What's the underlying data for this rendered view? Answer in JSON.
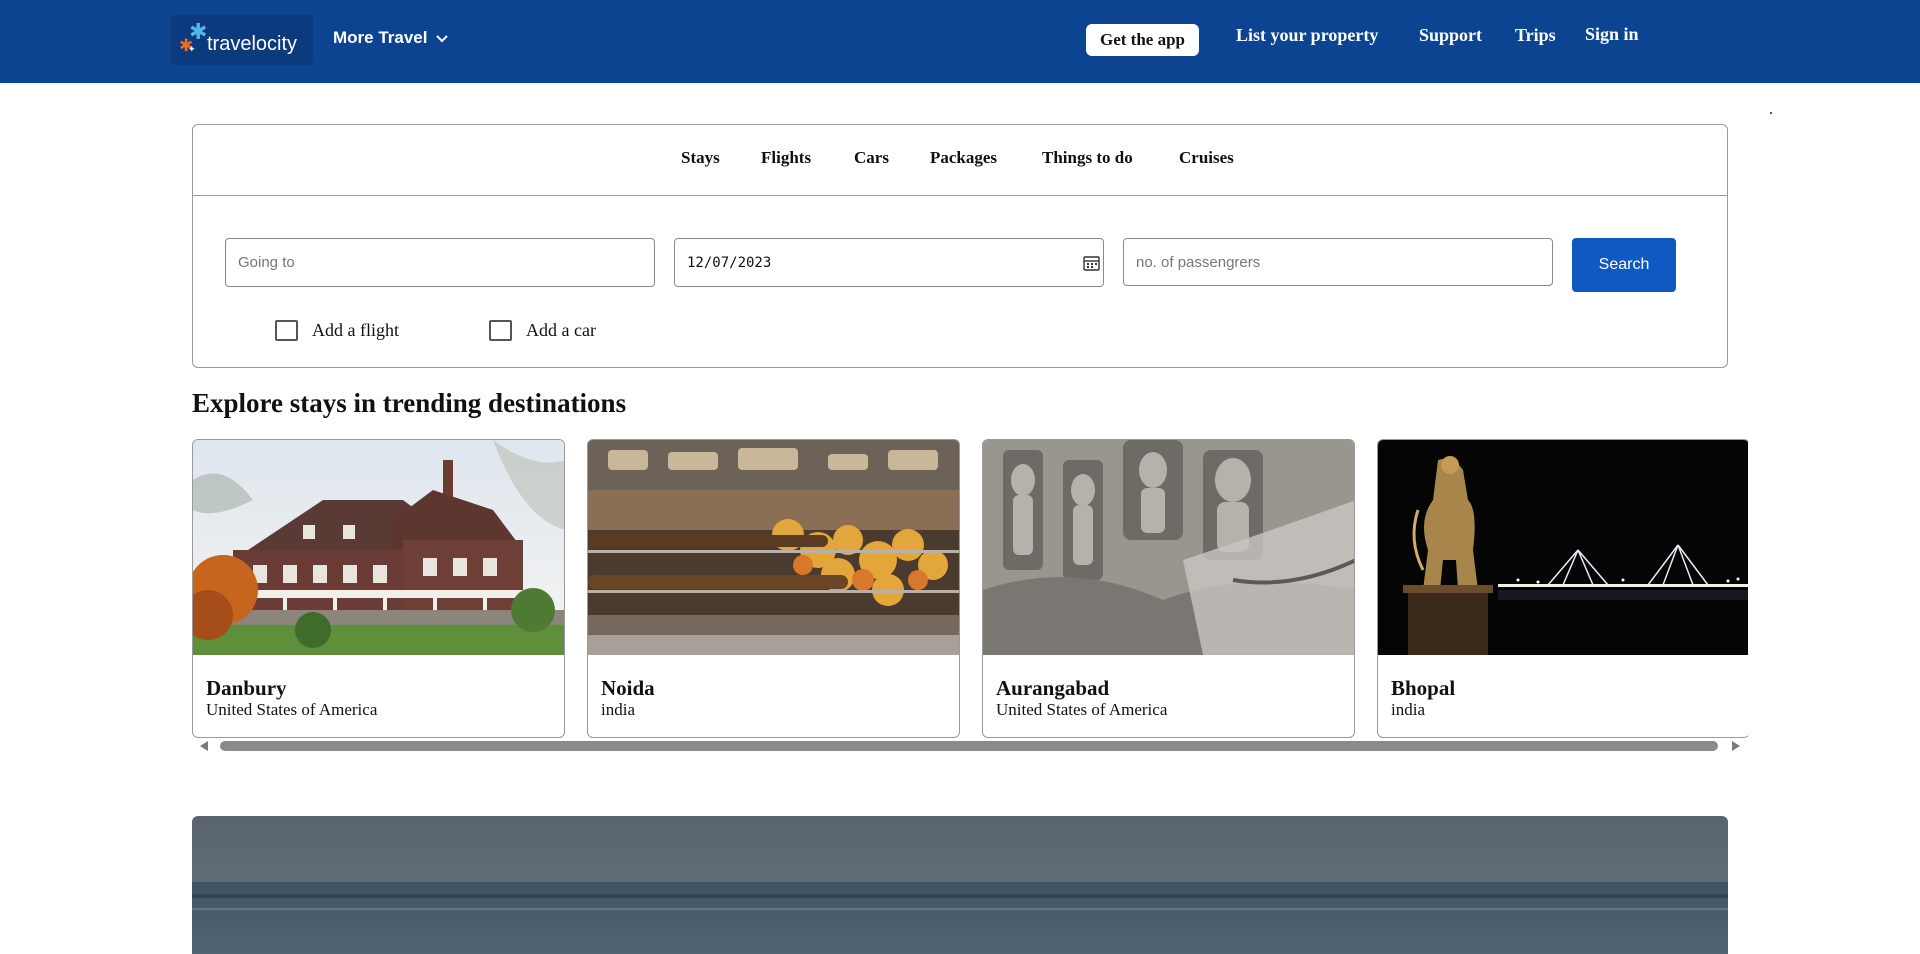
{
  "header": {
    "logo_text": "travelocity",
    "more_travel": "More Travel",
    "get_app": "Get the app",
    "links": [
      "List your property",
      "Support",
      "Trips",
      "Sign in"
    ],
    "bg_color": "#0d4491"
  },
  "search": {
    "tabs": [
      "Stays",
      "Flights",
      "Cars",
      "Packages",
      "Things to do",
      "Cruises"
    ],
    "destination_placeholder": "Going to",
    "date_value": "12/07/2023",
    "passengers_placeholder": "no. of passengrers",
    "search_button": "Search",
    "add_flight": "Add a flight",
    "add_car": "Add a car",
    "button_color": "#1159c2"
  },
  "trending": {
    "title": "Explore stays in trending destinations",
    "cards": [
      {
        "name": "Danbury",
        "country": "United States of America",
        "image": "victorian-house"
      },
      {
        "name": "Noida",
        "country": "india",
        "image": "street-food-grill"
      },
      {
        "name": "Aurangabad",
        "country": "United States of America",
        "image": "stone-carvings"
      },
      {
        "name": "Bhopal",
        "country": "india",
        "image": "statue-night-bridge"
      }
    ]
  }
}
